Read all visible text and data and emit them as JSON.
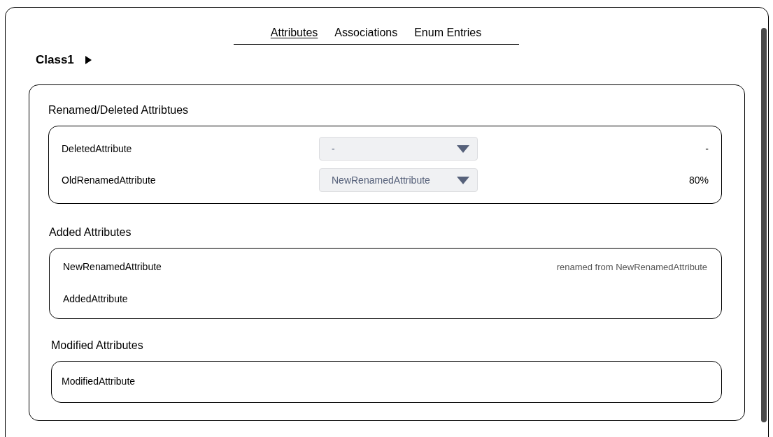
{
  "tabs": [
    {
      "label": "Attributes",
      "selected": true
    },
    {
      "label": "Associations",
      "selected": false
    },
    {
      "label": "Enum Entries",
      "selected": false
    }
  ],
  "class_name": "Class1",
  "sections": [
    {
      "kind": "renamed",
      "title": "Renamed/Deleted Attribtues",
      "rows": [
        {
          "name": "DeletedAttribute",
          "dropdown": "-",
          "score": "-"
        },
        {
          "name": "OldRenamedAttribute",
          "dropdown": "NewRenamedAttribute",
          "score": "80%"
        }
      ]
    },
    {
      "kind": "added",
      "title": "Added Attributes",
      "rows": [
        {
          "name": "NewRenamedAttribute",
          "note": "renamed from NewRenamedAttribute"
        },
        {
          "name": "AddedAttribute"
        }
      ]
    },
    {
      "kind": "modified",
      "title": "Modified Attributes",
      "rows": [
        {
          "name": "ModifiedAttribute"
        }
      ]
    }
  ]
}
